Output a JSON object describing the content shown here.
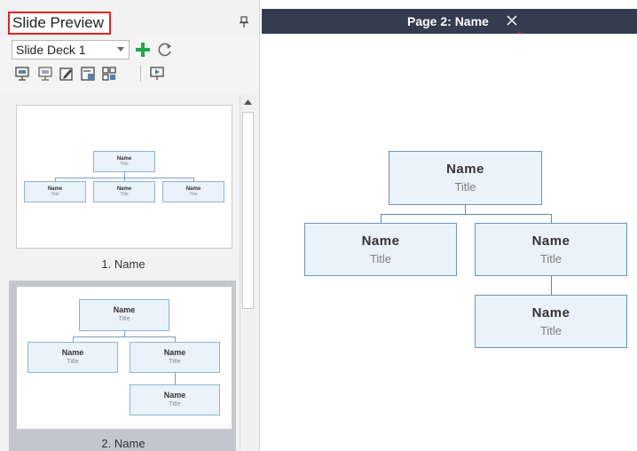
{
  "panel": {
    "title": "Slide Preview",
    "deck_select_value": "Slide Deck 1"
  },
  "toolbar": {
    "icons": [
      "present-icon",
      "present-alt-icon",
      "edit-icon",
      "export-icon",
      "grid-icon",
      "slideshow-icon"
    ]
  },
  "slides": [
    {
      "label": "1. Name",
      "nodes": [
        {
          "name": "Name",
          "title": "Title"
        },
        {
          "name": "Name",
          "title": "Title"
        },
        {
          "name": "Name",
          "title": "Title"
        },
        {
          "name": "Name",
          "title": "Title"
        }
      ]
    },
    {
      "label": "2. Name",
      "nodes": [
        {
          "name": "Name",
          "title": "Title"
        },
        {
          "name": "Name",
          "title": "Title"
        },
        {
          "name": "Name",
          "title": "Title"
        },
        {
          "name": "Name",
          "title": "Title"
        }
      ]
    }
  ],
  "tab": {
    "title": "Page 2: Name",
    "close_glyph": "×"
  },
  "chart": {
    "root": {
      "name": "Name",
      "title": "Title"
    },
    "left": {
      "name": "Name",
      "title": "Title"
    },
    "right": {
      "name": "Name",
      "title": "Title"
    },
    "right_child": {
      "name": "Name",
      "title": "Title"
    }
  },
  "colors": {
    "tab_bg": "#333d4f",
    "highlight_border": "#e02424",
    "node_fill": "#eaf2fb",
    "node_border": "#6c93b8",
    "add_green": "#1ea84a"
  }
}
